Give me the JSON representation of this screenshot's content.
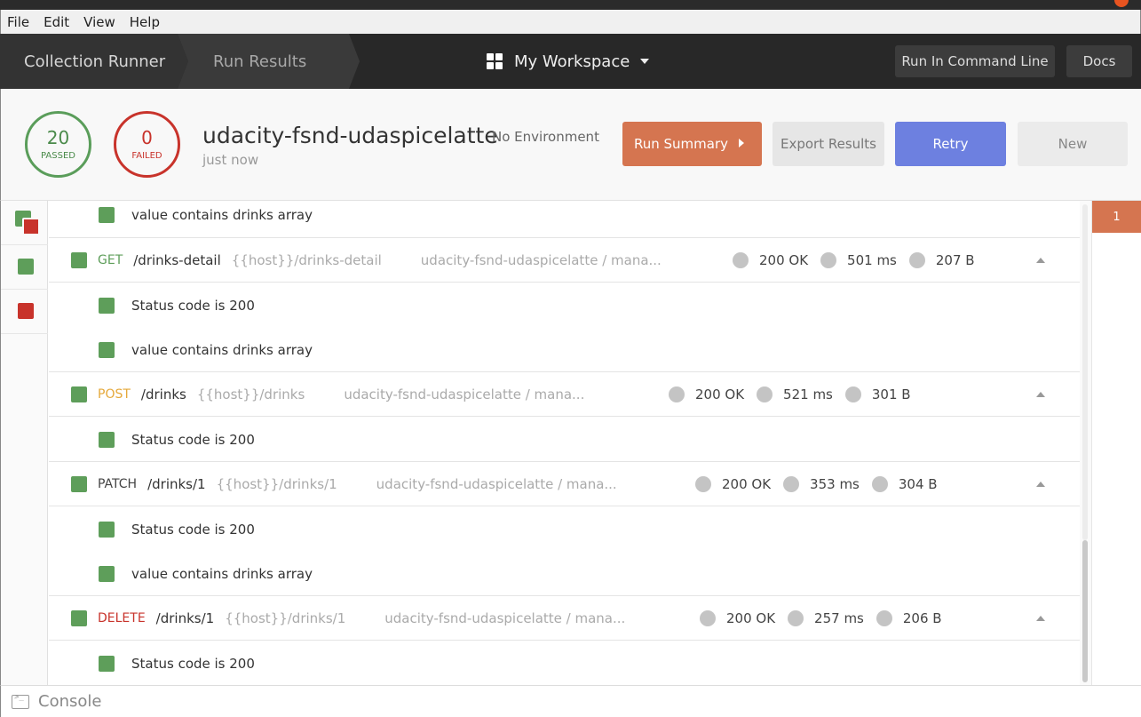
{
  "menubar": {
    "items": [
      "File",
      "Edit",
      "View",
      "Help"
    ]
  },
  "header": {
    "breadcrumb_runner": "Collection Runner",
    "breadcrumb_results": "Run Results",
    "workspace": "My Workspace",
    "run_cmd_label": "Run In Command Line",
    "docs_label": "Docs"
  },
  "summary": {
    "passed_count": "20",
    "passed_label": "PASSED",
    "failed_count": "0",
    "failed_label": "FAILED",
    "collection": "udacity-fsnd-udaspicelatte",
    "environment": "No Environment",
    "time": "just now",
    "run_summary_label": "Run Summary",
    "export_label": "Export Results",
    "retry_label": "Retry",
    "new_label": "New"
  },
  "results": {
    "row0_test": "value contains drinks array",
    "get": {
      "method": "GET",
      "path": "/drinks-detail",
      "url": "{{host}}/drinks-detail",
      "coll": "udacity-fsnd-udaspicelatte / mana...",
      "status": "200 OK",
      "time": "501 ms",
      "size": "207 B"
    },
    "get_tests": [
      "Status code is 200",
      "value contains drinks array"
    ],
    "post": {
      "method": "POST",
      "path": "/drinks",
      "url": "{{host}}/drinks",
      "coll": "udacity-fsnd-udaspicelatte / mana...",
      "status": "200 OK",
      "time": "521 ms",
      "size": "301 B"
    },
    "post_tests": [
      "Status code is 200"
    ],
    "patch": {
      "method": "PATCH",
      "path": "/drinks/1",
      "url": "{{host}}/drinks/1",
      "coll": "udacity-fsnd-udaspicelatte / mana...",
      "status": "200 OK",
      "time": "353 ms",
      "size": "304 B"
    },
    "patch_tests": [
      "Status code is 200",
      "value contains drinks array"
    ],
    "delete": {
      "method": "DELETE",
      "path": "/drinks/1",
      "url": "{{host}}/drinks/1",
      "coll": "udacity-fsnd-udaspicelatte / mana...",
      "status": "200 OK",
      "time": "257 ms",
      "size": "206 B"
    },
    "delete_tests": [
      "Status code is 200"
    ]
  },
  "iteration_badge": "1",
  "console": {
    "label": "Console"
  },
  "colors": {
    "pass": "#5e9e5a",
    "fail": "#c8332b",
    "run_summary": "#d57550",
    "retry": "#6d80e0"
  }
}
